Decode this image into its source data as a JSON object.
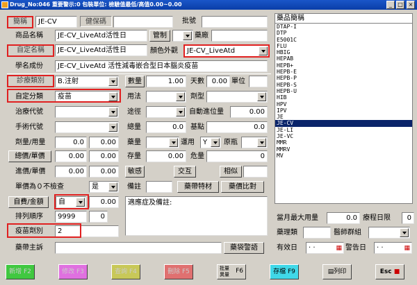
{
  "window": {
    "title": "Drug_No:046 重要警示:0 包裝單位: 檢驗值最低/高值0.00~0.00"
  },
  "form": {
    "l_code": "簡稱",
    "v_code": "JE-CV",
    "l_nhi": "健保碼",
    "l_approval": "批號",
    "l_product": "商品名稱",
    "v_product": "JE-CV_LiveAtd活性日",
    "b_manage": "管制",
    "l_factory": "藥廠",
    "l_custom": "自定名稱",
    "v_custom": "JE-CV_LiveAtd活性日",
    "l_color": "顏色外觀",
    "v_color": "JE-CV_LiveAtd",
    "l_ingredient": "學名成份",
    "v_ingredient": "JE-CV_LiveAtd 活性減毒嵌合型日本腦炎疫苗",
    "l_cat": "診療類別",
    "v_cat": "B.注射",
    "l_qty": "數量",
    "v_qty": "1.00",
    "l_days": "天數",
    "v_days": "0.00",
    "l_unit": "單位",
    "l_selfcat": "自定分類",
    "v_selfcat": "疫苗",
    "l_usage": "用法",
    "l_form": "劑型",
    "l_treat": "治療代號",
    "l_route": "途徑",
    "l_autoqty": "自動進位量",
    "v_autoqty": "0.00",
    "l_surgery": "手術代號",
    "l_total": "總量",
    "v_total": "0.0",
    "l_base": "基點",
    "v_base": "0.0",
    "l_dose": "劑量/用量",
    "v_dose1": "0.0",
    "v_dose2": "0.00",
    "l_drugqty": "藥量",
    "l_apply": "運用",
    "v_apply": "Y",
    "l_origin": "原瓶",
    "b_totalprice": "總價/單價",
    "v_tp1": "0.00",
    "v_tp2": "0.00",
    "l_stock": "存量",
    "v_stock": "0.00",
    "l_safe": "危量",
    "v_safe": "0",
    "l_inprice": "進價/單價",
    "v_ip1": "0.00",
    "v_ip2": "0.00",
    "b_sensitive": "敏感",
    "b_interact": "交互",
    "b_similar": "相似",
    "l_zero": "單價為０不檢查",
    "v_zero": "是",
    "l_note": "備註",
    "b_special": "藥帶特材",
    "b_compare": "藥價比對",
    "b_selfpay": "自費/金額",
    "v_selfpay": "自",
    "v_selfamt": "0.00",
    "l_indic": "適應症及備註:",
    "l_sort": "排列順序",
    "v_sort": "9999",
    "v_sort2": "0",
    "l_vaccine": "疫苗劑別",
    "v_vaccine": "2",
    "l_bagnote": "藥帶主訴",
    "b_bagwarn": "藥袋警語"
  },
  "list": {
    "header": "藥品簡稱",
    "items": [
      "DTAP-I",
      "DTP",
      "E5001C",
      "FLU",
      "HBIG",
      "HEPAB",
      "HEPB+",
      "HEPB-E",
      "HEPB-P",
      "HEPB-S",
      "HEPB-U",
      "HIB",
      "HPV",
      "IPV",
      "JE",
      "JE-CV",
      "JE-LI",
      "JE-VC",
      "MMR",
      "MMRV",
      "MV"
    ],
    "selected": "JE-CV"
  },
  "side": {
    "l_maxmonth": "當月最大用量",
    "v_maxmonth": "0.0",
    "l_course": "療程日限",
    "v_course": "0",
    "l_drugmgr": "藥理類",
    "l_doctor": "醫師群組",
    "l_effdate": "有效日",
    "v_effdate": "· ·",
    "l_alertdate": "警告日",
    "v_alertdate": "· ·"
  },
  "footer": {
    "add": "新增 F2",
    "edit": "修改 F3",
    "query": "查詢 F4",
    "delete": "刪除 F5",
    "batch1": "批量",
    "batch2": "異量",
    "batchkey": "F6",
    "save": "存檔 F9",
    "print": "列印",
    "esc": "Esc"
  }
}
